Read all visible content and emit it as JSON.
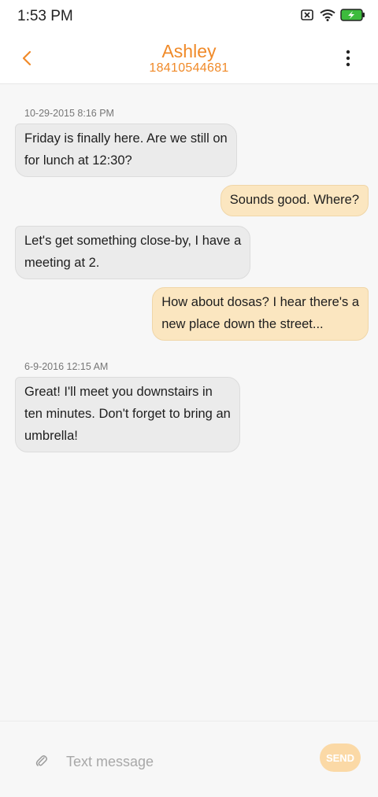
{
  "status_bar": {
    "time": "1:53 PM",
    "icons": [
      "sim-off-icon",
      "wifi-icon",
      "battery-charging-icon"
    ],
    "battery_color": "#3dbb3d"
  },
  "header": {
    "contact_name": "Ashley",
    "contact_number": "18410544681",
    "accent_color": "#f08a29",
    "back_icon": "chevron-left-icon",
    "more_icon": "more-vertical-icon"
  },
  "messages": {
    "ts1": "10-29-2015 8:16 PM",
    "m1": {
      "direction": "incoming",
      "line1": "Friday is finally here. Are we still on",
      "line2": "for lunch at 12:30?"
    },
    "m2": {
      "direction": "outgoing",
      "line1": "Sounds good. Where?"
    },
    "m3": {
      "direction": "incoming",
      "line1": "Let's get something close-by, I have a",
      "line2": "meeting at 2."
    },
    "m4": {
      "direction": "outgoing",
      "line1": "How about dosas? I hear there's a",
      "line2": "new place down the street..."
    },
    "ts2": "6-9-2016 12:15 AM",
    "m5": {
      "direction": "incoming",
      "line1": "Great! I'll meet you downstairs in",
      "line2": "ten minutes. Don't forget to bring an",
      "line3": "umbrella!"
    }
  },
  "composer": {
    "placeholder": "Text message",
    "value": "",
    "send_label": "SEND",
    "attach_icon": "paperclip-icon"
  }
}
